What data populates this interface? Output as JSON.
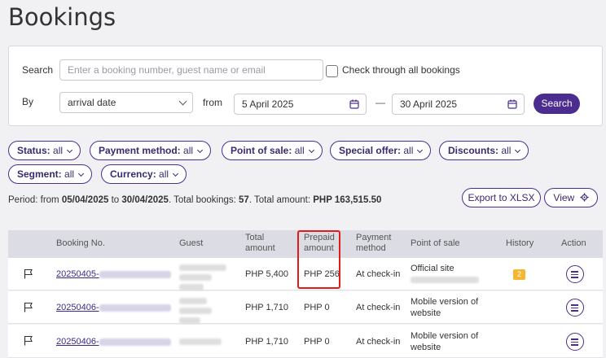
{
  "page": {
    "title": "Bookings"
  },
  "search": {
    "label": "Search",
    "placeholder": "Enter a booking number, guest name or email",
    "check_all_label": "Check through all bookings",
    "by_label": "By",
    "by_value": "arrival date",
    "from_label": "from",
    "date_from": "5 April 2025",
    "dash": "—",
    "date_to": "30 April 2025",
    "button": "Search"
  },
  "filters": [
    {
      "name": "Status:",
      "value": "all"
    },
    {
      "name": "Payment method:",
      "value": "all"
    },
    {
      "name": "Point of sale:",
      "value": "all"
    },
    {
      "name": "Special offer:",
      "value": "all"
    },
    {
      "name": "Discounts:",
      "value": "all"
    },
    {
      "name": "Segment:",
      "value": "all"
    },
    {
      "name": "Currency:",
      "value": "all"
    }
  ],
  "summary": {
    "period_label": "Period: from ",
    "from": "05/04/2025",
    "to_label": " to ",
    "to": "30/04/2025",
    "total_label": ". Total bookings: ",
    "total": "57",
    "amount_label": ". Total amount: ",
    "amount": "PHP 163,515.50"
  },
  "actions": {
    "export": "Export to XLSX",
    "view": "View"
  },
  "table": {
    "headers": {
      "booking": "Booking No.",
      "guest": "Guest",
      "total1": "Total",
      "total2": "amount",
      "prepaid1": "Prepaid",
      "prepaid2": "amount",
      "payment1": "Payment",
      "payment2": "method",
      "pos": "Point of sale",
      "history": "History",
      "action": "Action"
    },
    "rows": [
      {
        "booking": "20250405-",
        "total": "PHP 5,400",
        "prepaid": "PHP 256",
        "payment": "At check-in",
        "pos1": "Official site",
        "pos2": "",
        "history": "2"
      },
      {
        "booking": "20250406-",
        "total": "PHP 1,710",
        "prepaid": "PHP 0",
        "payment": "At check-in",
        "pos1": "Mobile version of",
        "pos2": "website",
        "history": ""
      },
      {
        "booking": "20250406-",
        "total": "PHP 1,710",
        "prepaid": "PHP 0",
        "payment": "At check-in",
        "pos1": "Mobile version of",
        "pos2": "website",
        "history": ""
      }
    ]
  },
  "colors": {
    "accent": "#4a2d8f",
    "highlight": "#e01b1b",
    "badge": "#f5b730"
  }
}
